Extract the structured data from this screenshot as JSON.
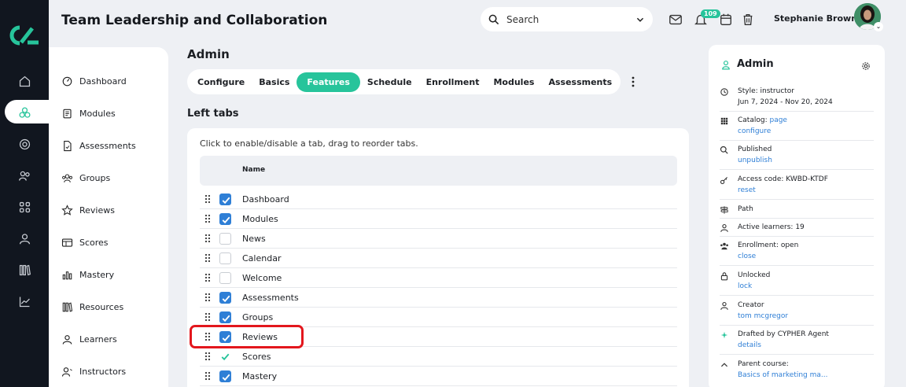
{
  "app": {
    "title": "Team Leadership and Collaboration"
  },
  "header": {
    "search_placeholder": "Search",
    "notification_count": "109",
    "user_name": "Stephanie Brown"
  },
  "nav": [
    {
      "label": "Dashboard",
      "icon": "dashboard-icon"
    },
    {
      "label": "Modules",
      "icon": "modules-icon"
    },
    {
      "label": "Assessments",
      "icon": "assessments-icon"
    },
    {
      "label": "Groups",
      "icon": "groups-icon"
    },
    {
      "label": "Reviews",
      "icon": "star-icon"
    },
    {
      "label": "Scores",
      "icon": "table-icon"
    },
    {
      "label": "Mastery",
      "icon": "bar-chart-icon"
    },
    {
      "label": "Resources",
      "icon": "books-icon"
    },
    {
      "label": "Learners",
      "icon": "person-icon"
    },
    {
      "label": "Instructors",
      "icon": "instructor-icon"
    }
  ],
  "main": {
    "section_title": "Admin",
    "tabs": [
      "Configure",
      "Basics",
      "Features",
      "Schedule",
      "Enrollment",
      "Modules",
      "Assessments"
    ],
    "active_tab": "Features",
    "subsection_title": "Left tabs",
    "hint": "Click to enable/disable a tab, drag to reorder tabs.",
    "column_name": "Name",
    "rows": [
      {
        "label": "Dashboard",
        "state": "checked"
      },
      {
        "label": "Modules",
        "state": "checked"
      },
      {
        "label": "News",
        "state": "unchecked"
      },
      {
        "label": "Calendar",
        "state": "unchecked"
      },
      {
        "label": "Welcome",
        "state": "unchecked"
      },
      {
        "label": "Assessments",
        "state": "checked"
      },
      {
        "label": "Groups",
        "state": "checked"
      },
      {
        "label": "Reviews",
        "state": "checked"
      },
      {
        "label": "Scores",
        "state": "locked"
      },
      {
        "label": "Mastery",
        "state": "checked"
      }
    ]
  },
  "right_panel": {
    "title": "Admin",
    "items": [
      {
        "text": "Style: instructor",
        "sub": "Jun 7, 2024 - Nov 20, 2024",
        "icon": "clock-icon"
      },
      {
        "text": "Catalog:",
        "inline_link": "page",
        "link": "configure",
        "icon": "grid-icon"
      },
      {
        "text": "Published",
        "link": "unpublish",
        "icon": "search-icon"
      },
      {
        "text": "Access code: KWBD-KTDF",
        "link": "reset",
        "icon": "key-icon"
      },
      {
        "text": "Path",
        "icon": "signpost-icon"
      },
      {
        "text": "Active learners: 19",
        "icon": "person-icon"
      },
      {
        "text": "Enrollment: open",
        "link": "close",
        "icon": "people-icon"
      },
      {
        "text": "Unlocked",
        "link": "lock",
        "icon": "lock-icon"
      },
      {
        "text": "Creator",
        "link": "tom mcgregor",
        "icon": "person-icon"
      },
      {
        "text": "Drafted by CYPHER Agent",
        "link": "details",
        "icon": "sparkle-icon"
      },
      {
        "text": "Parent course:",
        "link": "Basics of marketing ma...",
        "icon": "chevron-up-icon"
      }
    ]
  },
  "colors": {
    "accent": "#27c49b",
    "checkbox": "#2f7fd6",
    "highlight": "#e3171d",
    "rail": "#11161f"
  }
}
